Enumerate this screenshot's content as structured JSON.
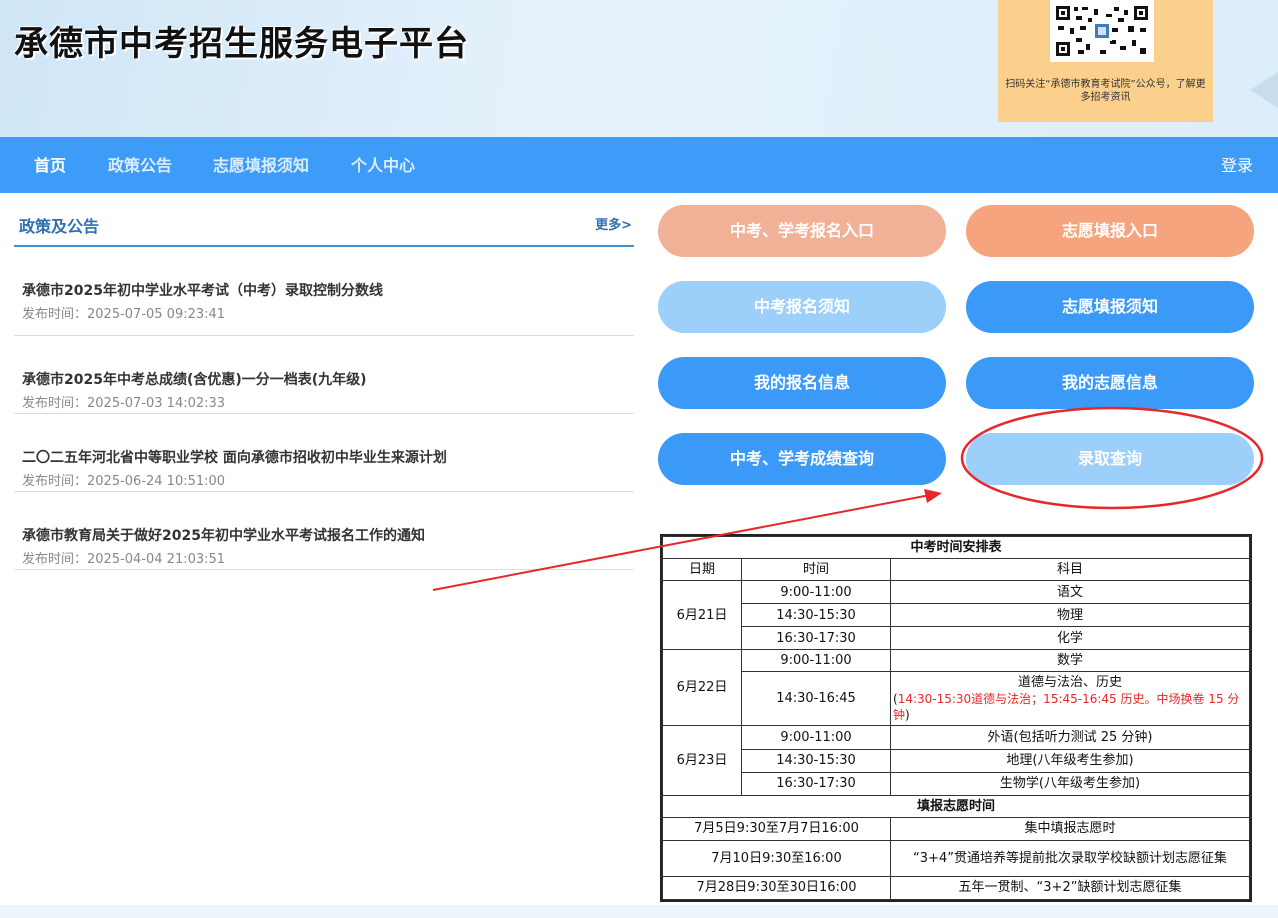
{
  "header": {
    "site_title": "承德市中考招生服务电子平台",
    "qr_caption": "扫码关注“承德市教育考试院”公众号，了解更多招考资讯"
  },
  "nav": {
    "items": [
      "首页",
      "政策公告",
      "志愿填报须知",
      "个人中心"
    ],
    "login": "登录"
  },
  "notices": {
    "title": "政策及公告",
    "more": "更多>",
    "items": [
      {
        "title": "承德市2025年初中学业水平考试（中考）录取控制分数线",
        "date": "发布时间：2025-07-05 09:23:41"
      },
      {
        "title": "承德市2025年中考总成绩(含优惠)一分一档表(九年级)",
        "date": "发布时间：2025-07-03 14:02:33"
      },
      {
        "title": "二〇二五年河北省中等职业学校 面向承德市招收初中毕业生来源计划",
        "date": "发布时间：2025-06-24 10:51:00"
      },
      {
        "title": "承德市教育局关于做好2025年初中学业水平考试报名工作的通知",
        "date": "发布时间：2025-04-04 21:03:51"
      }
    ]
  },
  "buttons": {
    "register": "中考、学考报名入口",
    "volunteer": "志愿填报入口",
    "register_notice": "中考报名须知",
    "volunteer_notice": "志愿填报须知",
    "my_register": "我的报名信息",
    "my_volunteer": "我的志愿信息",
    "score_query": "中考、学考成绩查询",
    "admission_query": "录取查询"
  },
  "schedule": {
    "title": "中考时间安排表",
    "headers": [
      "日期",
      "时间",
      "科目"
    ],
    "days": [
      {
        "date": "6月21日",
        "rows": [
          [
            "9:00-11:00",
            "语文"
          ],
          [
            "14:30-15:30",
            "物理"
          ],
          [
            "16:30-17:30",
            "化学"
          ]
        ]
      },
      {
        "date": "6月22日",
        "rows": [
          [
            "9:00-11:00",
            "数学"
          ]
        ],
        "special_time": "14:30-16:45",
        "special_subject": "道德与法治、历史",
        "special_note_open": "(",
        "special_note_red": "14:30-15:30道德与法治；15:45-16:45 历史。中场换卷 15 分钟",
        "special_note_close": ")"
      },
      {
        "date": "6月23日",
        "rows": [
          [
            "9:00-11:00",
            "外语(包括听力测试 25 分钟)"
          ],
          [
            "14:30-15:30",
            "地理(八年级考生参加)"
          ],
          [
            "16:30-17:30",
            "生物学(八年级考生参加)"
          ]
        ]
      }
    ],
    "volunteer_title": "填报志愿时间",
    "volunteer_rows": [
      [
        "7月5日9:30至7月7日16:00",
        "集中填报志愿时"
      ],
      [
        "7月10日9:30至16:00",
        "“3+4”贯通培养等提前批次录取学校缺额计划志愿征集"
      ],
      [
        "7月28日9:30至30日16:00",
        "五年一贯制、“3+2”缺额计划志愿征集"
      ]
    ]
  },
  "colors": {
    "nav_bg": "#3d9cf7",
    "annotation_red": "#e8272b"
  }
}
